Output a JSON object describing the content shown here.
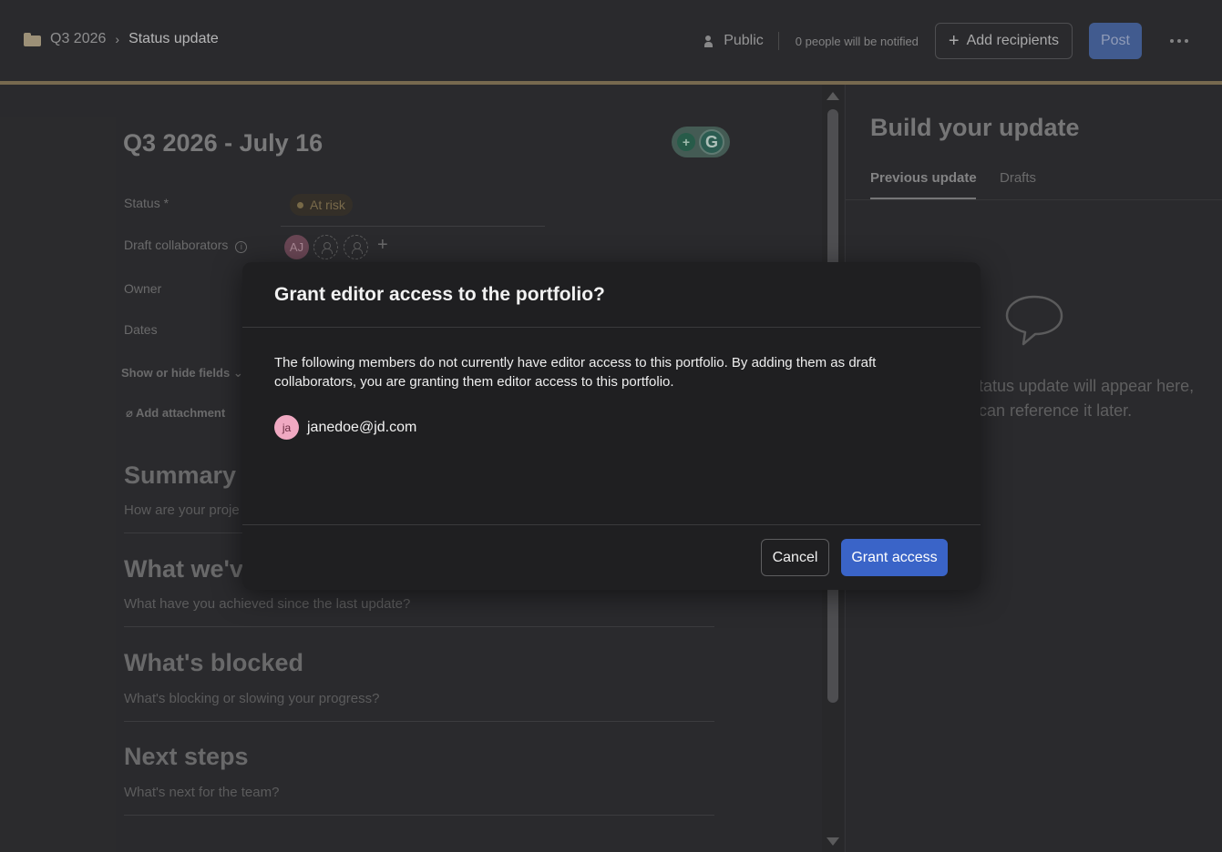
{
  "breadcrumb": {
    "portfolio": "Q3 2026",
    "separator": "›",
    "current": "Status update"
  },
  "header": {
    "visibility": "Public",
    "notify_text": "0 people will be notified",
    "add_recipients": "Add recipients",
    "post": "Post"
  },
  "editor": {
    "title": "Q3 2026 - July 16",
    "grammarly_bulb": "+",
    "grammarly_logo": "G",
    "fields": {
      "status_label": "Status *",
      "status_value": "At risk",
      "collaborators_label": "Draft collaborators",
      "collaborator_initials": "AJ",
      "owner_label": "Owner",
      "dates_label": "Dates",
      "show_hide": "Show or hide fields",
      "add_attachment": "Add attachment"
    },
    "sections": [
      {
        "heading": "Summary",
        "placeholder": "How are your proje"
      },
      {
        "heading": "What we'v",
        "placeholder": "What have you achieved since the last update?"
      },
      {
        "heading": "What's blocked",
        "placeholder": "What's blocking or slowing your progress?"
      },
      {
        "heading": "Next steps",
        "placeholder": "What's next for the team?"
      }
    ]
  },
  "right_panel": {
    "title": "Build your update",
    "tabs": [
      "Previous update",
      "Drafts"
    ],
    "empty_text": "tatus update will appear here, can reference it later."
  },
  "modal": {
    "title": "Grant editor access to the portfolio?",
    "body": "The following members do not currently have editor access to this portfolio. By adding them as draft collaborators, you are granting them editor access to this portfolio.",
    "member": {
      "initials": "ja",
      "email": "janedoe@jd.com"
    },
    "cancel": "Cancel",
    "confirm": "Grant access"
  },
  "colors": {
    "accent": "#3a64c8",
    "header_rule": "#8c7b5a",
    "avatar_pink": "#f0a9c2"
  }
}
